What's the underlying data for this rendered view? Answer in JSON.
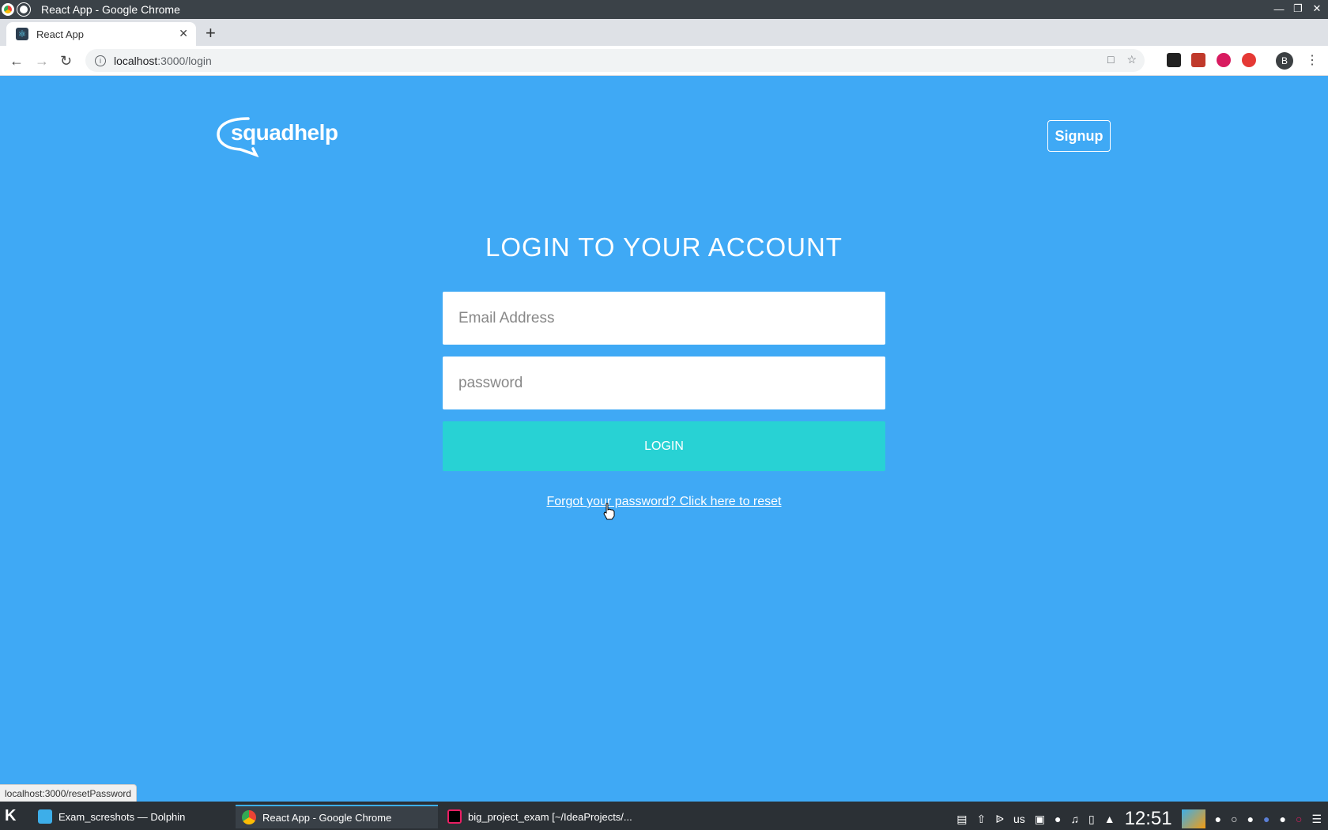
{
  "window": {
    "title": "React App - Google Chrome",
    "controls": [
      "minimize",
      "restore",
      "close"
    ]
  },
  "browser": {
    "tab": {
      "title": "React App",
      "close": "✕"
    },
    "new_tab": "+",
    "url_host": "localhost",
    "url_path": ":3000/login",
    "status_url": "localhost:3000/resetPassword",
    "profile_initial": "B"
  },
  "header": {
    "logo_text": "squadhelp",
    "signup_label": "Signup"
  },
  "login": {
    "heading": "LOGIN TO YOUR ACCOUNT",
    "email_placeholder": "Email Address",
    "password_placeholder": "password",
    "submit_label": "LOGIN",
    "reset_link": "Forgot your password? Click here to reset"
  },
  "taskbar": {
    "tasks": [
      {
        "label": "Exam_screshots — Dolphin",
        "icon": "folder-icon"
      },
      {
        "label": "React App - Google Chrome",
        "icon": "chrome-icon"
      },
      {
        "label": "big_project_exam [~/IdeaProjects/...",
        "icon": "intellij-icon"
      }
    ],
    "keyboard_layout": "us",
    "clock": "12:51"
  },
  "colors": {
    "page_bg": "#3fa9f5",
    "login_button": "#28d2d4"
  }
}
